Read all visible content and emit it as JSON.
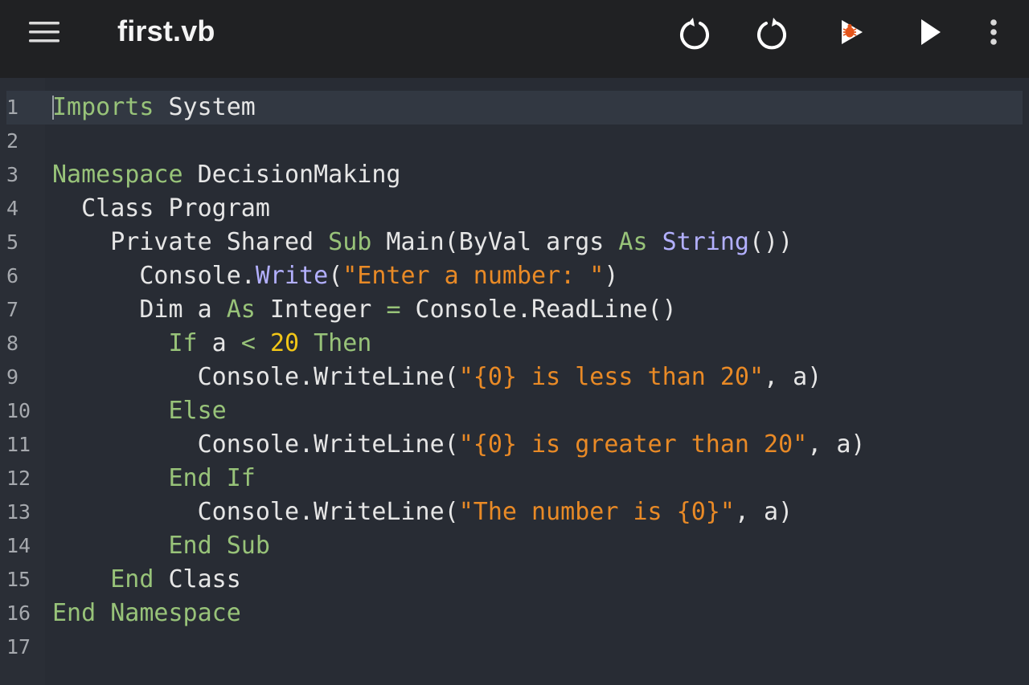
{
  "app": {
    "title": "first.vb"
  },
  "toolbar": {
    "icons": [
      "menu-icon",
      "undo-icon",
      "redo-icon",
      "debug-icon",
      "run-icon",
      "more-vertical-icon"
    ]
  },
  "theme": {
    "keyword": "#98c379",
    "type": "#b3b0ff",
    "string": "#e98a26",
    "number": "#f2c617",
    "text": "#e6e6e6",
    "line_number": "#a6a9ae"
  },
  "editor": {
    "lines": [
      {
        "num": "1",
        "tokens": [
          {
            "t": "Imports",
            "c": "keyword"
          },
          {
            "t": " System",
            "c": "text"
          }
        ]
      },
      {
        "num": "2",
        "tokens": []
      },
      {
        "num": "3",
        "tokens": [
          {
            "t": "Namespace",
            "c": "keyword"
          },
          {
            "t": " DecisionMaking",
            "c": "text"
          }
        ]
      },
      {
        "num": "4",
        "tokens": [
          {
            "t": "  Class Program",
            "c": "text"
          }
        ]
      },
      {
        "num": "5",
        "tokens": [
          {
            "t": "    Private Shared ",
            "c": "text"
          },
          {
            "t": "Sub",
            "c": "keyword"
          },
          {
            "t": " Main(ByVal args ",
            "c": "text"
          },
          {
            "t": "As",
            "c": "keyword"
          },
          {
            "t": " ",
            "c": "text"
          },
          {
            "t": "String",
            "c": "type"
          },
          {
            "t": "())",
            "c": "text"
          }
        ]
      },
      {
        "num": "6",
        "tokens": [
          {
            "t": "      Console.",
            "c": "text"
          },
          {
            "t": "Write",
            "c": "type"
          },
          {
            "t": "(",
            "c": "text"
          },
          {
            "t": "\"Enter a number: \"",
            "c": "string"
          },
          {
            "t": ")",
            "c": "text"
          }
        ]
      },
      {
        "num": "7",
        "tokens": [
          {
            "t": "      Dim a ",
            "c": "text"
          },
          {
            "t": "As",
            "c": "keyword"
          },
          {
            "t": " Integer ",
            "c": "text"
          },
          {
            "t": "=",
            "c": "keyword"
          },
          {
            "t": " Console.ReadLine()",
            "c": "text"
          }
        ]
      },
      {
        "num": "8",
        "tokens": [
          {
            "t": "        ",
            "c": "text"
          },
          {
            "t": "If",
            "c": "keyword"
          },
          {
            "t": " a ",
            "c": "text"
          },
          {
            "t": "<",
            "c": "keyword"
          },
          {
            "t": " ",
            "c": "text"
          },
          {
            "t": "20",
            "c": "number"
          },
          {
            "t": " ",
            "c": "text"
          },
          {
            "t": "Then",
            "c": "keyword"
          }
        ]
      },
      {
        "num": "9",
        "tokens": [
          {
            "t": "          Console.WriteLine(",
            "c": "text"
          },
          {
            "t": "\"{0} is less than 20\"",
            "c": "string"
          },
          {
            "t": ", a)",
            "c": "text"
          }
        ]
      },
      {
        "num": "10",
        "tokens": [
          {
            "t": "        ",
            "c": "text"
          },
          {
            "t": "Else",
            "c": "keyword"
          }
        ]
      },
      {
        "num": "11",
        "tokens": [
          {
            "t": "          Console.WriteLine(",
            "c": "text"
          },
          {
            "t": "\"{0} is greater than 20\"",
            "c": "string"
          },
          {
            "t": ", a)",
            "c": "text"
          }
        ]
      },
      {
        "num": "12",
        "tokens": [
          {
            "t": "        ",
            "c": "text"
          },
          {
            "t": "End If",
            "c": "keyword"
          }
        ]
      },
      {
        "num": "13",
        "tokens": [
          {
            "t": "          Console.WriteLine(",
            "c": "text"
          },
          {
            "t": "\"The number is {0}\"",
            "c": "string"
          },
          {
            "t": ", a)",
            "c": "text"
          }
        ]
      },
      {
        "num": "14",
        "tokens": [
          {
            "t": "        ",
            "c": "text"
          },
          {
            "t": "End Sub",
            "c": "keyword"
          }
        ]
      },
      {
        "num": "15",
        "tokens": [
          {
            "t": "    ",
            "c": "text"
          },
          {
            "t": "End",
            "c": "keyword"
          },
          {
            "t": " Class",
            "c": "text"
          }
        ]
      },
      {
        "num": "16",
        "tokens": [
          {
            "t": "End Namespace",
            "c": "keyword"
          }
        ]
      },
      {
        "num": "17",
        "tokens": []
      }
    ]
  }
}
